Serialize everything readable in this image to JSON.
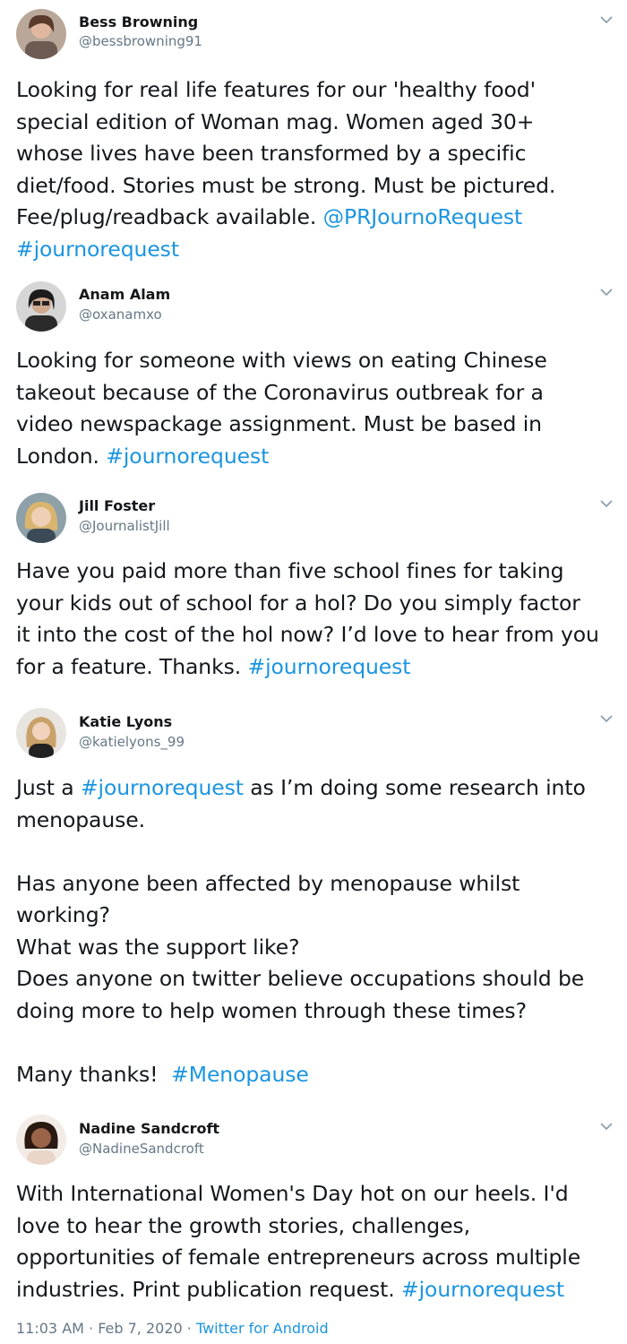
{
  "tweets": [
    {
      "name": "Bess Browning",
      "handle": "@bessbrowning91",
      "lines": [
        [
          "Looking for real life features for our 'healthy food'"
        ],
        [
          "special edition of Woman mag. Women aged 30+"
        ],
        [
          "whose lives have been transformed by a specific"
        ],
        [
          "diet/food. Stories must be strong. Must be pictured."
        ],
        [
          "Fee/plug/readback available. ",
          "@PRJournoRequest"
        ],
        [
          "",
          "#journorequest"
        ]
      ]
    },
    {
      "name": "Anam Alam",
      "handle": "@oxanamxo",
      "lines": [
        [
          "Looking for someone with views on eating Chinese"
        ],
        [
          "takeout because of the Coronavirus outbreak for a"
        ],
        [
          "video newspackage assignment. Must be based in"
        ],
        [
          "London. ",
          "#journorequest"
        ]
      ]
    },
    {
      "name": "Jill Foster",
      "handle": "@JournalistJill",
      "lines": [
        [
          "Have you paid more than five school fines for taking"
        ],
        [
          "your kids out of school for a hol? Do you simply factor"
        ],
        [
          "it into the cost of the hol now? I’d love to hear from you"
        ],
        [
          "for a feature. Thanks. ",
          "#journorequest"
        ]
      ]
    },
    {
      "name": "Katie Lyons",
      "handle": "@katielyons_99",
      "lines": [
        [
          "Just a ",
          "#journorequest",
          " as I’m doing some research into"
        ],
        [
          "menopause."
        ],
        [],
        [
          "Has anyone been affected by menopause whilst"
        ],
        [
          "working?"
        ],
        [
          "What was the support like?"
        ],
        [
          "Does anyone on twitter believe occupations should be"
        ],
        [
          "doing more to help women through these times?"
        ],
        [],
        [
          "Many thanks!  ",
          "#Menopause"
        ]
      ]
    },
    {
      "name": "Nadine Sandcroft",
      "handle": "@NadineSandcroft",
      "lines": [
        [
          "With International Women's Day hot on our heels. I'd"
        ],
        [
          "love to hear the growth stories, challenges,"
        ],
        [
          "opportunities of female entrepreneurs across multiple"
        ],
        [
          "industries. Print publication request. ",
          "#journorequest"
        ]
      ]
    }
  ],
  "footer": {
    "time": "11:03 AM · Feb 7, 2020 · ",
    "source": "Twitter for Android"
  },
  "colors": {
    "link": "#1b95e0",
    "muted": "#657786",
    "text": "#14171a"
  },
  "icons": {
    "chevron": "chevron-down-icon",
    "avatar": "avatar"
  }
}
